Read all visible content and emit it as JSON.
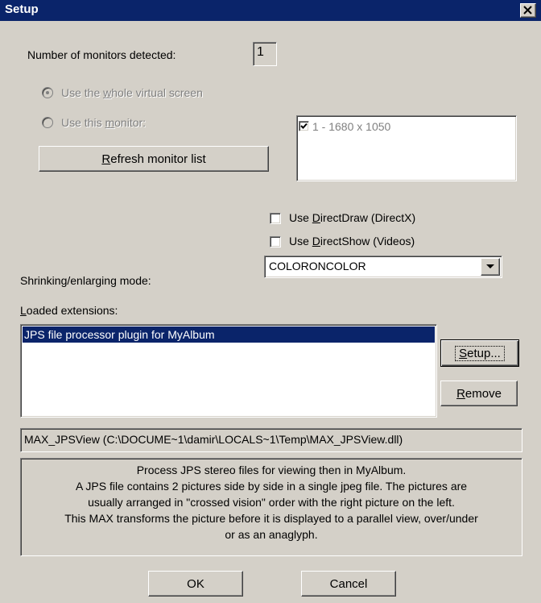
{
  "window": {
    "title": "Setup"
  },
  "monitors": {
    "count_label": "Number of monitors detected:",
    "count_value": "1",
    "radio_whole": {
      "pre": "Use the ",
      "u": "w",
      "post": "hole virtual screen"
    },
    "radio_this": {
      "pre": "Use this ",
      "u": "m",
      "post": "onitor:"
    },
    "refresh": {
      "pre": "",
      "u": "R",
      "post": "efresh monitor list"
    },
    "list_item": "1 - 1680 x 1050"
  },
  "options": {
    "directdraw": {
      "pre": "Use ",
      "u": "D",
      "post": "irectDraw (DirectX)"
    },
    "directshow": {
      "pre": "Use ",
      "u": "D",
      "post": "irectShow (Videos)"
    },
    "shrink_label": "Shrinking/enlarging mode:",
    "shrink_value": "COLORONCOLOR"
  },
  "extensions": {
    "label": {
      "pre": "",
      "u": "L",
      "post": "oaded extensions:"
    },
    "items": [
      "JPS file processor plugin for MyAlbum"
    ],
    "setup": {
      "pre": "",
      "u": "S",
      "post": "etup..."
    },
    "remove": {
      "pre": "",
      "u": "R",
      "post": "emove"
    },
    "path": "MAX_JPSView (C:\\DOCUME~1\\damir\\LOCALS~1\\Temp\\MAX_JPSView.dll)",
    "description": [
      "Process JPS stereo files for viewing then in MyAlbum.",
      "A JPS file contains 2 pictures side by side in a single jpeg file.  The pictures are",
      "usually arranged in \"crossed vision\" order with the right picture on the left.",
      "This MAX transforms the picture before it is displayed to a parallel view, over/under",
      "or as an anaglyph."
    ]
  },
  "footer": {
    "ok": "OK",
    "cancel": "Cancel"
  },
  "colors": {
    "title_bar": "#0a246a",
    "face": "#d4d0c8",
    "selection": "#0a246a"
  }
}
